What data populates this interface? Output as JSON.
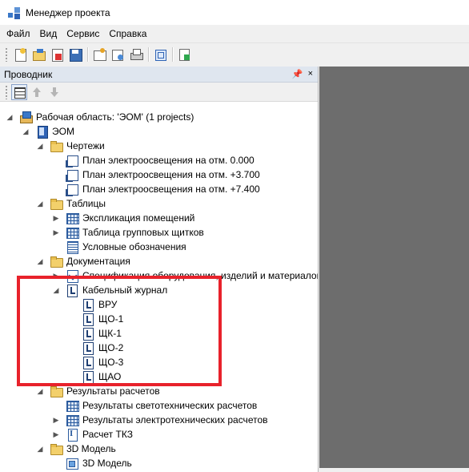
{
  "window": {
    "title": "Менеджер проекта"
  },
  "menu": [
    {
      "id": "file",
      "label": "Файл"
    },
    {
      "id": "view",
      "label": "Вид"
    },
    {
      "id": "service",
      "label": "Сервис"
    },
    {
      "id": "help",
      "label": "Справка"
    }
  ],
  "toolbar": {
    "buttons": [
      {
        "icon": "new-project-icon"
      },
      {
        "icon": "open-project-icon"
      },
      {
        "icon": "close-project-icon"
      },
      {
        "icon": "save-icon"
      },
      {
        "icon": "properties-icon"
      },
      {
        "icon": "settings-icon"
      },
      {
        "icon": "print-icon"
      },
      {
        "icon": "structure-icon"
      },
      {
        "icon": "add-document-icon"
      }
    ]
  },
  "explorer": {
    "title": "Проводник",
    "pin_glyph": "📌",
    "close_glyph": "×",
    "toolbar": [
      "tree-view-icon",
      "move-up-icon",
      "move-down-icon"
    ]
  },
  "tree": {
    "workspace": "Рабочая область: 'ЭОМ' (1 projects)",
    "project": "ЭОМ",
    "drawings": {
      "label": "Чертежи",
      "items": [
        "План электроосвещения на отм. 0.000",
        "План электроосвещения на отм. +3.700",
        "План электроосвещения на отм. +7.400"
      ]
    },
    "tables": {
      "label": "Таблицы",
      "items": [
        "Экспликация помещений",
        "Таблица групповых щитков",
        "Условные обозначения"
      ]
    },
    "documentation": {
      "label": "Документация",
      "spec": "Спецификация оборудования, изделий и материалов",
      "cable_journal": {
        "label": "Кабельный журнал",
        "items": [
          "ВРУ",
          "ЩО-1",
          "ЩК-1",
          "ЩО-2",
          "ЩО-3",
          "ЩАО"
        ]
      }
    },
    "results": {
      "label": "Результаты расчетов",
      "items": [
        "Результаты светотехнических расчетов",
        "Результаты электротехнических расчетов",
        "Расчет ТКЗ"
      ]
    },
    "model3d": {
      "label": "3D Модель",
      "items": [
        "3D Модель"
      ]
    },
    "expander_expanded": "◢",
    "expander_collapsed": "▶"
  },
  "colors": {
    "highlight": "#e8222b",
    "workspace_bg": "#6d6d6d",
    "panel_header": "#dfe6ef"
  }
}
